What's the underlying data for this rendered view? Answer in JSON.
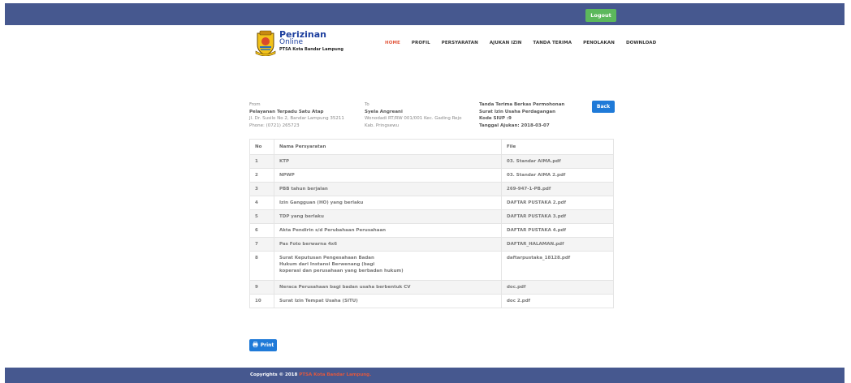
{
  "header": {
    "logout_label": "Logout"
  },
  "brand": {
    "title": "Perizinan",
    "subtitle": "Online",
    "org": "PTSA Kota Bandar Lampung"
  },
  "nav": [
    {
      "label": "HOME",
      "active": true
    },
    {
      "label": "PROFIL",
      "active": false
    },
    {
      "label": "PERSYARATAN",
      "active": false
    },
    {
      "label": "AJUKAN IZIN",
      "active": false
    },
    {
      "label": "TANDA TERIMA",
      "active": false
    },
    {
      "label": "PENOLAKAN",
      "active": false
    },
    {
      "label": "DOWNLOAD",
      "active": false
    }
  ],
  "from": {
    "label": "From",
    "name": "Pelayanan Terpadu Satu Atap",
    "address": "Jl. Dr. Susilo No 2, Bandar Lampung 35211",
    "phone": "Phone: (0721) 265723"
  },
  "to": {
    "label": "To",
    "name": "Syela Angreani",
    "address": "Wonodadi RT/RW 001/001 Kec. Gading Rejo",
    "city": "Kab. Pringsewu"
  },
  "receipt": {
    "title": "Tanda Terima Berkas Permohonan",
    "permit": "Surat Izin Usaha Perdagangan",
    "code": "Kode SIUP :9",
    "date": "Tanggal Ajukan: 2018-03-07"
  },
  "back_label": "Back",
  "table": {
    "headers": [
      "No",
      "Nama Persyaratan",
      "File"
    ],
    "rows": [
      {
        "no": "1",
        "name": "KTP",
        "file": "03. Standar AIMA.pdf"
      },
      {
        "no": "2",
        "name": "NPWP",
        "file": "03. Standar AIMA 2.pdf"
      },
      {
        "no": "3",
        "name": "PBB tahun berjalan",
        "file": "269-947-1-PB.pdf"
      },
      {
        "no": "4",
        "name": "Izin Gangguan (HO) yang berlaku",
        "file": "DAFTAR PUSTAKA 2.pdf"
      },
      {
        "no": "5",
        "name": "TDP yang berlaku",
        "file": "DAFTAR PUSTAKA 3.pdf"
      },
      {
        "no": "6",
        "name": "Akta Pendirin s/d Perubahaan Perusahaan",
        "file": "DAFTAR PUSTAKA 4.pdf"
      },
      {
        "no": "7",
        "name": "Pas Foto berwarna 4x6",
        "file": "DAFTAR_HALAMAN.pdf"
      },
      {
        "no": "8",
        "name": "Surat Keputusan Pengesahaan Badan\nHukum dari Instansi Berwenang (bagi\nkoperasi dan perusahaan yang berbadan hukum)",
        "file": "daftarpustaka_18128.pdf"
      },
      {
        "no": "9",
        "name": "Neraca Perusahaan bagi badan usaha berbentuk CV",
        "file": "doc.pdf"
      },
      {
        "no": "10",
        "name": "Surat Izin Tempat Usaha (SITU)",
        "file": "doc 2.pdf"
      }
    ]
  },
  "print_label": "Print",
  "footer": {
    "prefix": "Copyrights © 2018 ",
    "org": "PTSA Kota Bandar Lampung."
  },
  "colors": {
    "bar": "#46588f",
    "primary": "#1f7ad8",
    "success": "#5cb85c",
    "accent": "#e2583e"
  }
}
